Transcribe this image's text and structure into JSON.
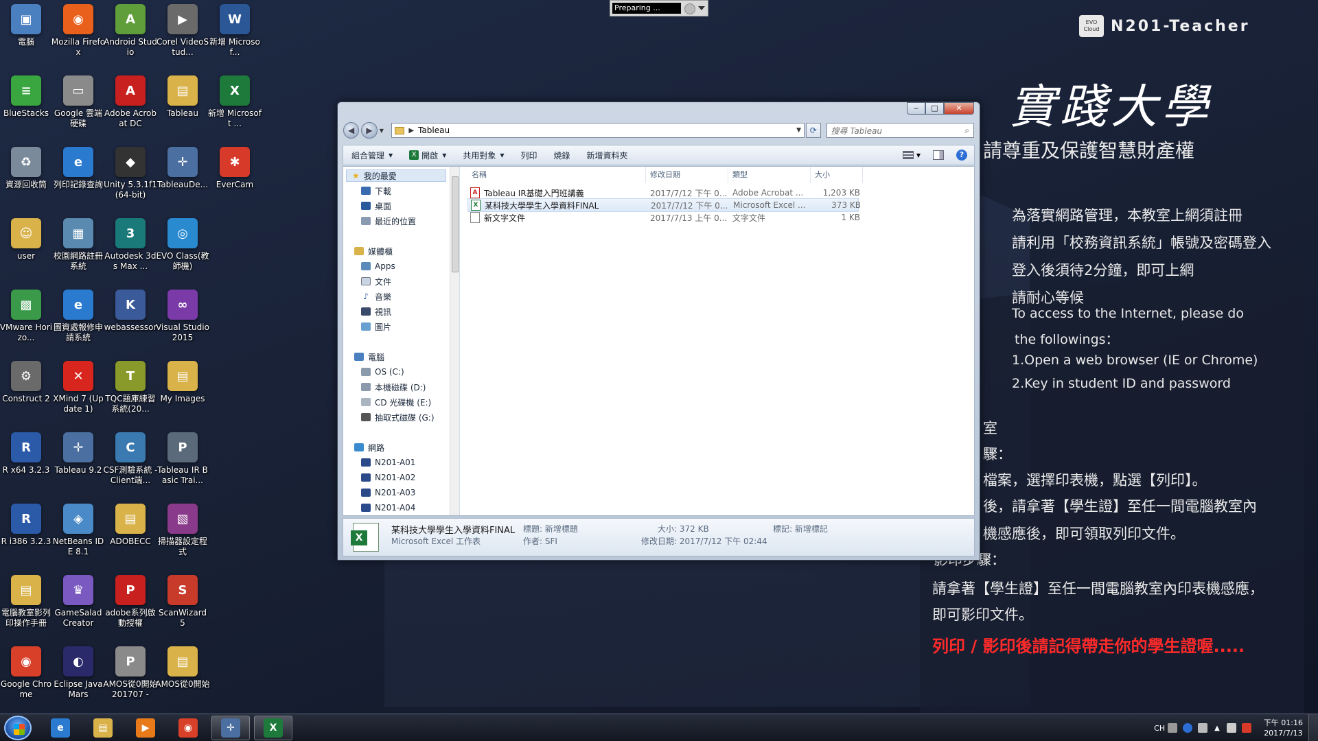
{
  "desktop_icons": [
    {
      "label": "電腦",
      "icon": "computer-icon",
      "color": "#4a7fc0",
      "glyph": "▣"
    },
    {
      "label": "Mozilla Firefox",
      "icon": "firefox-icon",
      "color": "#e8601c",
      "glyph": "◉"
    },
    {
      "label": "Android Studio",
      "icon": "android-studio-icon",
      "color": "#5f9e3a",
      "glyph": "A"
    },
    {
      "label": "Corel VideoStud...",
      "icon": "corel-videostudio-icon",
      "color": "#6a6a6a",
      "glyph": "▶"
    },
    {
      "label": "新增 Microsof...",
      "icon": "word-doc-icon",
      "color": "#2b5797",
      "glyph": "W"
    },
    {
      "label": "BlueStacks",
      "icon": "bluestacks-icon",
      "color": "#3aa640",
      "glyph": "≡"
    },
    {
      "label": "Google 雲端硬碟",
      "icon": "google-drive-icon",
      "color": "#8a8a8a",
      "glyph": "▭"
    },
    {
      "label": "Adobe Acrobat DC",
      "icon": "acrobat-icon",
      "color": "#c8201e",
      "glyph": "A"
    },
    {
      "label": "Tableau",
      "icon": "folder-icon",
      "color": "#d9b24a",
      "glyph": "▤"
    },
    {
      "label": "新增 Microsoft ...",
      "icon": "excel-doc-icon",
      "color": "#1e7a3a",
      "glyph": "X"
    },
    {
      "label": "資源回收筒",
      "icon": "recycle-bin-icon",
      "color": "#7a8a9a",
      "glyph": "♻"
    },
    {
      "label": "列印記錄查詢",
      "icon": "ie-icon",
      "color": "#2a7ad0",
      "glyph": "e"
    },
    {
      "label": "Unity 5.3.1f1 (64-bit)",
      "icon": "unity-icon",
      "color": "#333333",
      "glyph": "◆"
    },
    {
      "label": "TableauDe...",
      "icon": "tableau-desktop-icon",
      "color": "#4a6fa0",
      "glyph": "✛"
    },
    {
      "label": "EverCam",
      "icon": "evercam-icon",
      "color": "#d83a2a",
      "glyph": "✱"
    },
    {
      "label": "user",
      "icon": "user-folder-icon",
      "color": "#d9b24a",
      "glyph": "☺"
    },
    {
      "label": "校園網路註冊系統",
      "icon": "campus-register-icon",
      "color": "#5a8ab0",
      "glyph": "▦"
    },
    {
      "label": "Autodesk 3ds Max ...",
      "icon": "3dsmax-icon",
      "color": "#1a7a7a",
      "glyph": "3"
    },
    {
      "label": "EVO Class(教師機)",
      "icon": "evo-class-icon",
      "color": "#2a8ad0",
      "glyph": "◎"
    },
    {
      "label": "",
      "icon": "",
      "color": "",
      "glyph": ""
    },
    {
      "label": "VMware Horizo...",
      "icon": "vmware-icon",
      "color": "#3a9a4a",
      "glyph": "▩"
    },
    {
      "label": "圖資處報修申請系統",
      "icon": "ie-icon",
      "color": "#2a7ad0",
      "glyph": "e"
    },
    {
      "label": "webassessor",
      "icon": "webassessor-icon",
      "color": "#3a5a9a",
      "glyph": "K"
    },
    {
      "label": "Visual Studio 2015",
      "icon": "visual-studio-icon",
      "color": "#7a3aa8",
      "glyph": "∞"
    },
    {
      "label": "",
      "icon": "",
      "color": "",
      "glyph": ""
    },
    {
      "label": "Construct 2",
      "icon": "construct2-icon",
      "color": "#6a6a6a",
      "glyph": "⚙"
    },
    {
      "label": "XMind 7 (Update 1)",
      "icon": "xmind-icon",
      "color": "#d8261e",
      "glyph": "✕"
    },
    {
      "label": "TQC題庫練習系統(20...",
      "icon": "tqc-icon",
      "color": "#8a9a2a",
      "glyph": "T"
    },
    {
      "label": "My Images",
      "icon": "folder-icon",
      "color": "#d9b24a",
      "glyph": "▤"
    },
    {
      "label": "",
      "icon": "",
      "color": "",
      "glyph": ""
    },
    {
      "label": "R x64 3.2.3",
      "icon": "r-icon",
      "color": "#2a5aa8",
      "glyph": "R"
    },
    {
      "label": "Tableau 9.2",
      "icon": "tableau-icon",
      "color": "#4a6fa0",
      "glyph": "✛"
    },
    {
      "label": "CSF測驗系統 -Client端...",
      "icon": "csf-icon",
      "color": "#3a7ab0",
      "glyph": "C"
    },
    {
      "label": "Tableau IR Basic Trai...",
      "icon": "ppt-icon",
      "color": "#5a6a7a",
      "glyph": "P"
    },
    {
      "label": "",
      "icon": "",
      "color": "",
      "glyph": ""
    },
    {
      "label": "R i386 3.2.3",
      "icon": "r-icon",
      "color": "#2a5aa8",
      "glyph": "R"
    },
    {
      "label": "NetBeans IDE 8.1",
      "icon": "netbeans-icon",
      "color": "#4a8ac8",
      "glyph": "◈"
    },
    {
      "label": "ADOBECC",
      "icon": "folder-icon",
      "color": "#d9b24a",
      "glyph": "▤"
    },
    {
      "label": "掃描器設定程式",
      "icon": "scanner-icon",
      "color": "#8a3a8a",
      "glyph": "▧"
    },
    {
      "label": "",
      "icon": "",
      "color": "",
      "glyph": ""
    },
    {
      "label": "電腦教室影列印操作手冊",
      "icon": "folder-icon",
      "color": "#d9b24a",
      "glyph": "▤"
    },
    {
      "label": "GameSalad Creator",
      "icon": "gamesalad-icon",
      "color": "#7a5ac0",
      "glyph": "♛"
    },
    {
      "label": "adobe系列啟動授權",
      "icon": "pdf-icon",
      "color": "#c8201e",
      "glyph": "P"
    },
    {
      "label": "ScanWizard 5",
      "icon": "scanwizard-icon",
      "color": "#c83a2a",
      "glyph": "S"
    },
    {
      "label": "",
      "icon": "",
      "color": "",
      "glyph": ""
    },
    {
      "label": "Google Chrome",
      "icon": "chrome-icon",
      "color": "#d8402a",
      "glyph": "◉"
    },
    {
      "label": "Eclipse Java Mars",
      "icon": "eclipse-icon",
      "color": "#2a2a6a",
      "glyph": "◐"
    },
    {
      "label": "AMOS從0開始201707 -",
      "icon": "ppt-icon",
      "color": "#8a8a8a",
      "glyph": "P"
    },
    {
      "label": "AMOS從0開始",
      "icon": "folder-icon",
      "color": "#d9b24a",
      "glyph": "▤"
    }
  ],
  "preparing": {
    "text": "Preparing ..."
  },
  "brand": {
    "logo_text": "EVO Cloud",
    "name": "N201-Teacher",
    "university": "實踐大學"
  },
  "notices": {
    "ip": "請尊重及保護智慧財產權",
    "l1": "為落實網路管理，本教室上網須註冊",
    "l2": "請利用「校務資訊系統」帳號及密碼登入",
    "l3": "登入後須待2分鐘，即可上網",
    "l4": "請耐心等候",
    "e1": "To access to the Internet, please do",
    "e2": "the followings：",
    "e3": "1.Open a web browser (IE or Chrome)",
    "e4": "2.Key in student ID and password",
    "p0": "室",
    "p1": "驟：",
    "p2": "檔案，選擇印表機，點選【列印】。",
    "p3": "後，請拿著【學生證】至任一間電腦教室內",
    "p4": "機感應後，即可領取列印文件。",
    "p5": "影印步驟：",
    "p6": "請拿著【學生證】至任一間電腦教室內印表機感應，",
    "p7": "即可影印文件。",
    "warn": "列印 / 影印後請記得帶走你的學生證喔....."
  },
  "explorer": {
    "address": "Tableau",
    "search_placeholder": "搜尋 Tableau",
    "toolbar": {
      "organize": "組合管理",
      "open": "開啟",
      "share": "共用對象",
      "print": "列印",
      "burn": "燒錄",
      "new_folder": "新增資料夾"
    },
    "nav": {
      "favorites": "我的最愛",
      "downloads": "下載",
      "desktop": "桌面",
      "recent": "最近的位置",
      "libraries": "媒體櫃",
      "apps": "Apps",
      "documents": "文件",
      "music": "音樂",
      "videos": "視訊",
      "pictures": "圖片",
      "computer": "電腦",
      "drive_c": "OS (C:)",
      "drive_d": "本機磁碟 (D:)",
      "drive_e": "CD 光碟機 (E:)",
      "drive_g": "抽取式磁碟 (G:)",
      "network": "網路",
      "n1": "N201-A01",
      "n2": "N201-A02",
      "n3": "N201-A03",
      "n4": "N201-A04"
    },
    "columns": {
      "name": "名稱",
      "date": "修改日期",
      "type": "類型",
      "size": "大小"
    },
    "files": [
      {
        "name": "Tableau IR基礎入門班講義",
        "date": "2017/7/12 下午 0...",
        "type": "Adobe Acrobat ...",
        "size": "1,203 KB",
        "icon": "pdf-file-icon",
        "glyph": "A",
        "color": "#c8201e"
      },
      {
        "name": "某科技大學學生入學資料FINAL",
        "date": "2017/7/12 下午 0...",
        "type": "Microsoft Excel ...",
        "size": "373 KB",
        "icon": "excel-file-icon",
        "glyph": "X",
        "color": "#1e7a3a"
      },
      {
        "name": "新文字文件",
        "date": "2017/7/13 上午 0...",
        "type": "文字文件",
        "size": "1 KB",
        "icon": "text-file-icon",
        "glyph": "",
        "color": "#888888"
      }
    ],
    "details": {
      "filename": "某科技大學學生入學資料FINAL",
      "filetype": "Microsoft Excel 工作表",
      "title_label": "標題: 新增標題",
      "author_label": "作者: SFI",
      "size_label": "大小: 372 KB",
      "modified_label": "修改日期: 2017/7/12 下午 02:44",
      "tags_label": "標記: 新增標記"
    }
  },
  "taskbar": {
    "apps": [
      {
        "name": "taskbar-ie",
        "icon": "ie-icon",
        "glyph": "e",
        "color": "#2a7ad0",
        "active": false
      },
      {
        "name": "taskbar-explorer",
        "icon": "folder-icon",
        "glyph": "▤",
        "color": "#d9b24a",
        "active": false
      },
      {
        "name": "taskbar-media-player",
        "icon": "media-player-icon",
        "glyph": "▶",
        "color": "#e87a1a",
        "active": false
      },
      {
        "name": "taskbar-chrome",
        "icon": "chrome-icon",
        "glyph": "◉",
        "color": "#d8402a",
        "active": false
      },
      {
        "name": "taskbar-tableau",
        "icon": "tableau-icon",
        "glyph": "✛",
        "color": "#4a6fa0",
        "active": true
      },
      {
        "name": "taskbar-excel",
        "icon": "excel-icon",
        "glyph": "X",
        "color": "#1e7a3a",
        "active": true
      }
    ],
    "lang": "CH",
    "time": "下午 01:16",
    "date": "2017/7/13"
  }
}
